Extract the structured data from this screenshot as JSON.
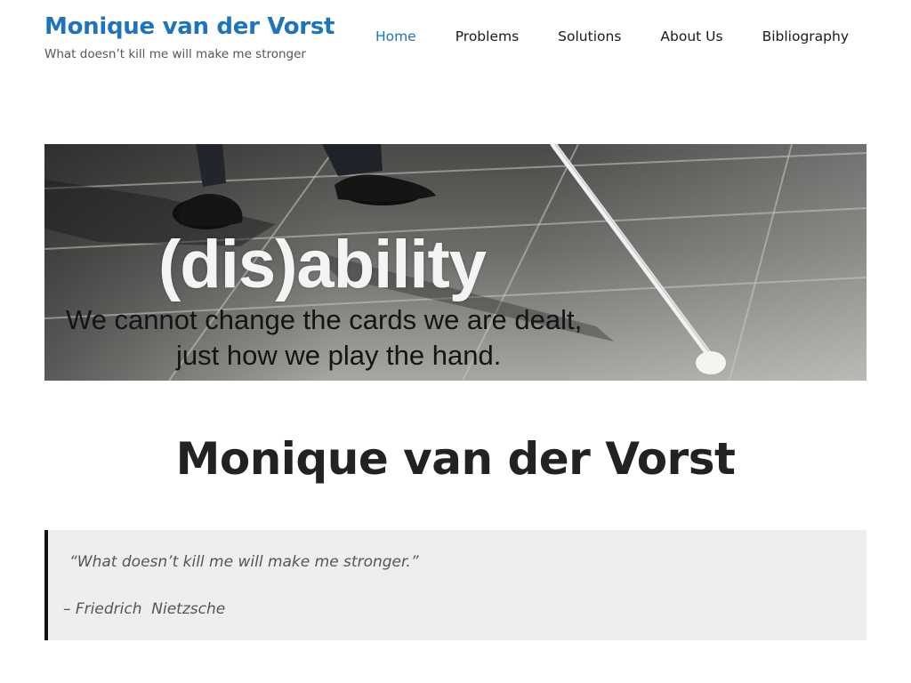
{
  "header": {
    "site_title": "Monique van der Vorst",
    "tagline": "What doesn’t kill me will make me stronger"
  },
  "nav": {
    "items": [
      {
        "label": "Home",
        "active": true
      },
      {
        "label": "Problems",
        "active": false
      },
      {
        "label": "Solutions",
        "active": false
      },
      {
        "label": "About Us",
        "active": false
      },
      {
        "label": "Bibliography",
        "active": false
      }
    ]
  },
  "hero": {
    "title": "(dis)ability",
    "line1": "We cannot change the cards we are dealt,",
    "line2": "just how we play the hand."
  },
  "page_title": "Monique van der Vorst",
  "quote": {
    "text": "“What doesn’t kill me will make me stronger.”",
    "cite": "– Friedrich  Nietzsche"
  },
  "colors": {
    "accent": "#1e73be",
    "quote_background": "#eeeeee",
    "quote_border": "#111111"
  }
}
